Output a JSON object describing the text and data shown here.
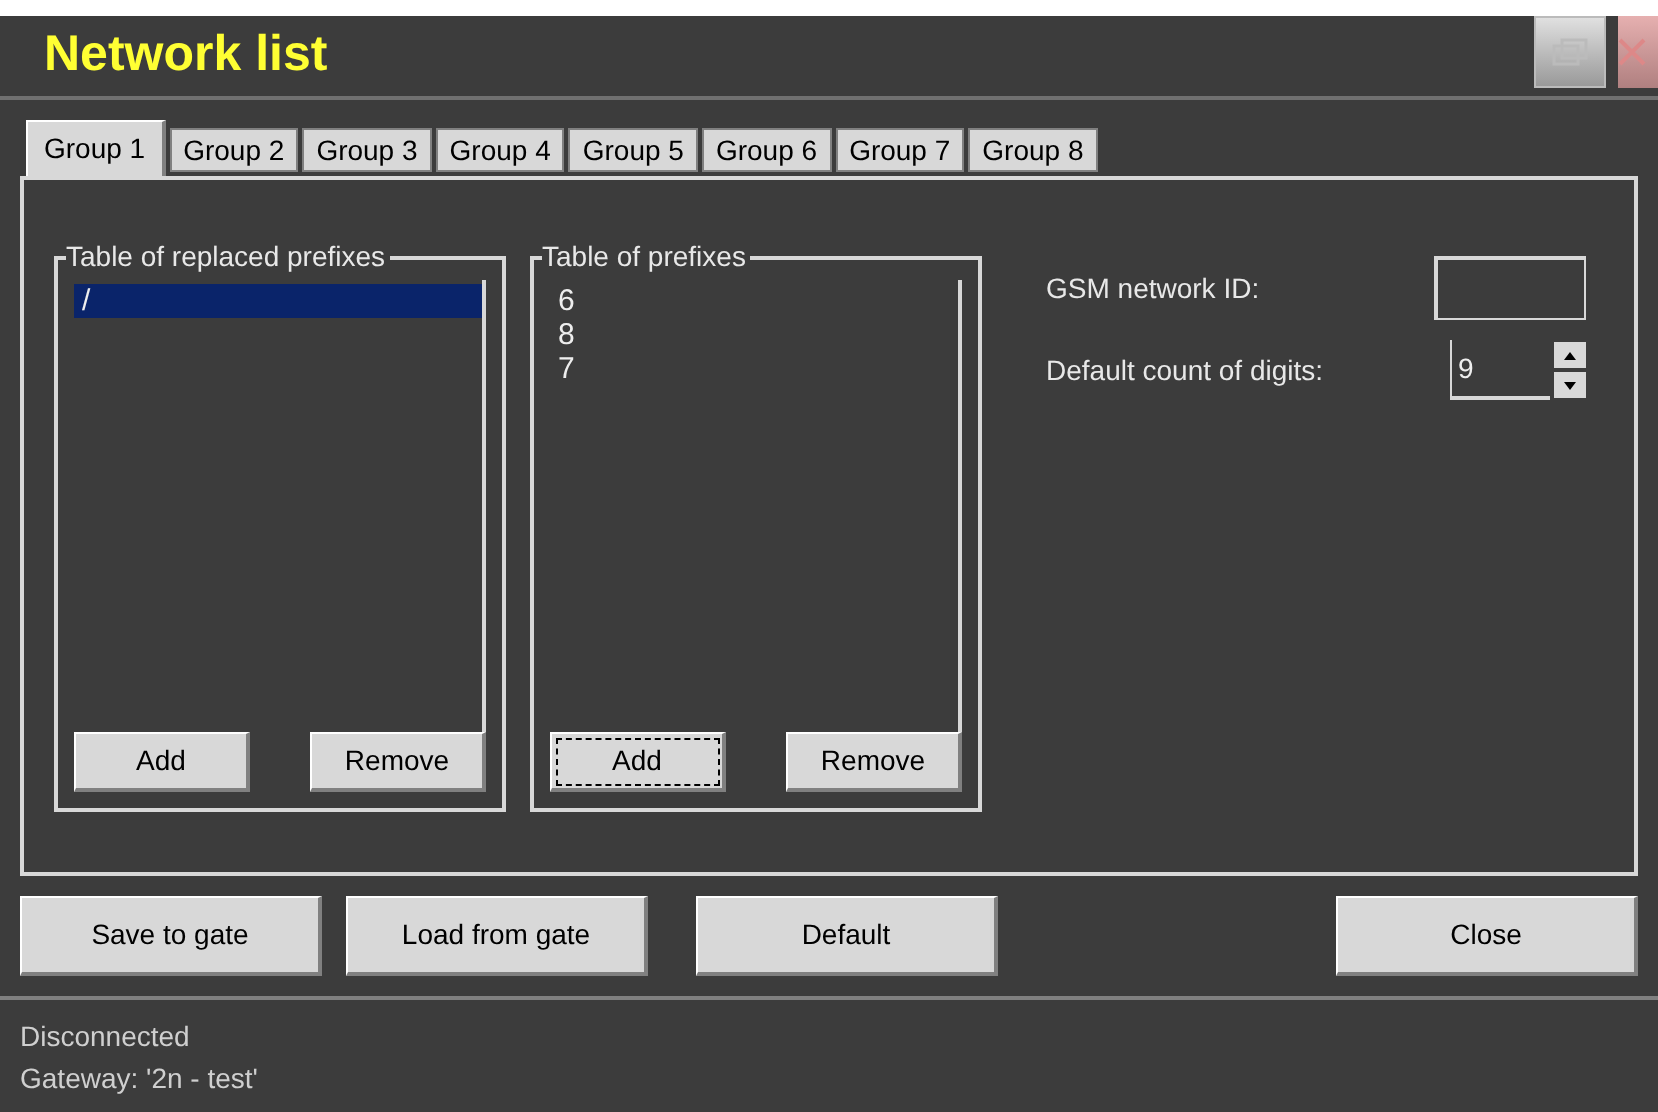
{
  "window": {
    "title": "Network list"
  },
  "tabs": [
    {
      "label": "Group 1",
      "selected": true
    },
    {
      "label": "Group 2",
      "selected": false
    },
    {
      "label": "Group 3",
      "selected": false
    },
    {
      "label": "Group 4",
      "selected": false
    },
    {
      "label": "Group 5",
      "selected": false
    },
    {
      "label": "Group 6",
      "selected": false
    },
    {
      "label": "Group 7",
      "selected": false
    },
    {
      "label": "Group 8",
      "selected": false
    }
  ],
  "groups": [
    {
      "title": "Table of replaced prefixes",
      "items": [
        {
          "text": "/",
          "selected": true
        }
      ],
      "buttons": [
        {
          "label": "Add",
          "focused": false
        },
        {
          "label": "Remove",
          "focused": false
        }
      ]
    },
    {
      "title": "Table of prefixes",
      "items": [
        {
          "text": "6",
          "selected": false
        },
        {
          "text": "8",
          "selected": false
        },
        {
          "text": "7",
          "selected": false
        }
      ],
      "buttons": [
        {
          "label": "Add",
          "focused": true
        },
        {
          "label": "Remove",
          "focused": false
        }
      ]
    }
  ],
  "gsm_network_id": {
    "label": "GSM network ID:"
  },
  "default_count": {
    "label": "Default count of digits:",
    "value": "9"
  },
  "buttons": [
    {
      "label": "Save to gate"
    },
    {
      "label": "Load from gate"
    },
    {
      "label": "Default"
    },
    {
      "label": "Close"
    }
  ],
  "status_bar": [
    "Disconnected",
    "Gateway: '2n - test'"
  ]
}
